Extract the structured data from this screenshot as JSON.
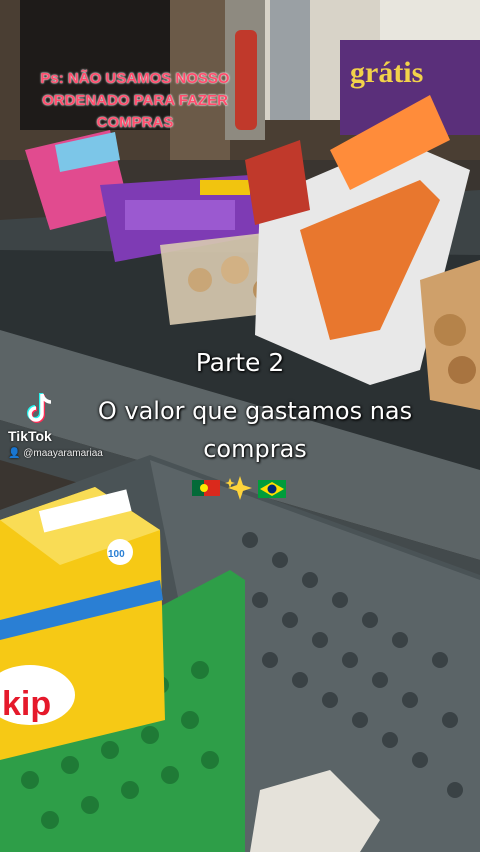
{
  "overlay": {
    "note_line1": "Ps: NÃO USAMOS NOSSO",
    "note_line2": "ORDENADO PARA FAZER",
    "note_line3": "COMPRAS",
    "part_label": "Parte 2",
    "caption_line1": "O valor que gastamos nas",
    "caption_line2": "compras",
    "emoji_names": [
      "portugal-flag-icon",
      "sparkles-icon",
      "brazil-flag-icon"
    ]
  },
  "watermark": {
    "brand": "TikTok",
    "username": "@maayaramariaa"
  },
  "scene_text": {
    "store_sign": "grátis",
    "box_brand": "kip",
    "box_badge": "100"
  }
}
